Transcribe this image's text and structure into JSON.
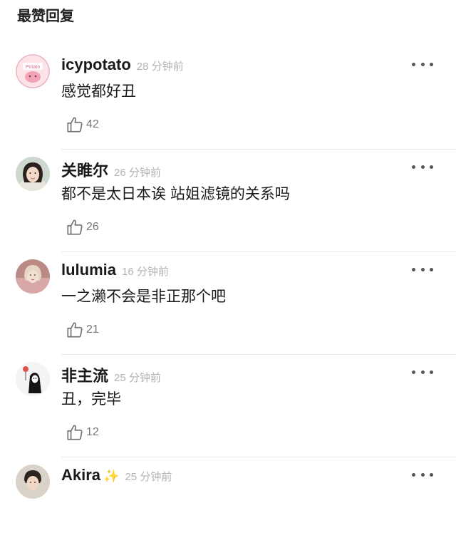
{
  "section_title": "最赞回复",
  "comments": [
    {
      "username": "icypotato",
      "time": "28 分钟前",
      "text": "感觉都好丑",
      "likes": "42"
    },
    {
      "username": "关睢尔",
      "time": "26 分钟前",
      "text": "都不是太日本诶 站姐滤镜的关系吗",
      "likes": "26"
    },
    {
      "username": "lulumia",
      "time": "16 分钟前",
      "text": "一之濑不会是非正那个吧",
      "likes": "21"
    },
    {
      "username": "非主流",
      "time": "25 分钟前",
      "text": "丑，完毕",
      "likes": "12"
    },
    {
      "username": "Akira",
      "time": "25 分钟前",
      "text": "",
      "likes": ""
    }
  ],
  "icons": {
    "more": "more-dots-icon",
    "like": "thumbs-up-icon"
  },
  "colors": {
    "time": "#b3b3b3",
    "divider": "#e6e6e6",
    "sparkle": "#f3b300"
  }
}
